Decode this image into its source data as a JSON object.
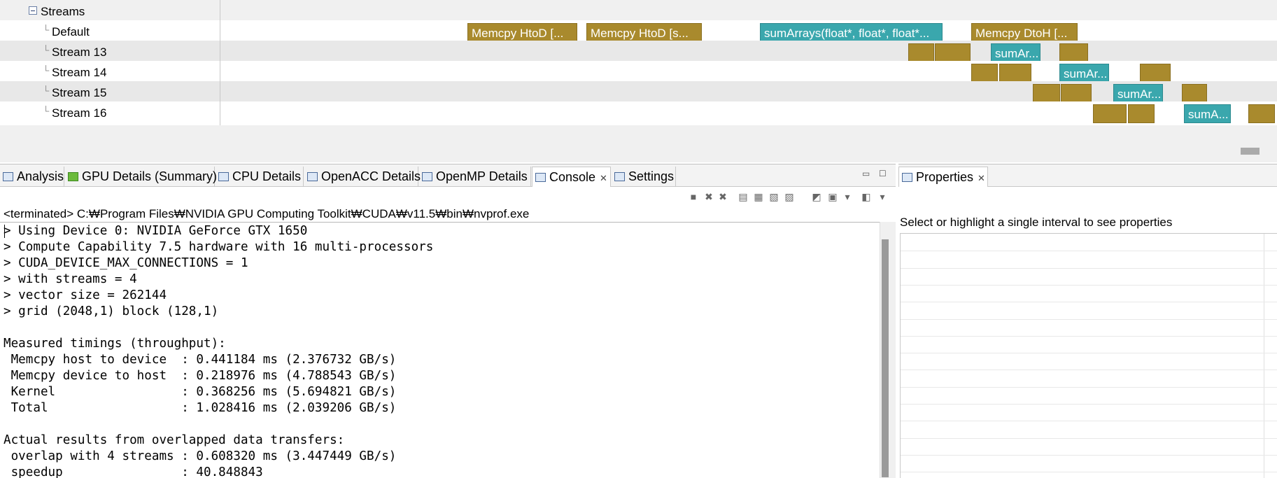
{
  "timeline": {
    "group_label": "Streams",
    "rows": [
      {
        "label": "Default",
        "bars": [
          {
            "type": "memcpy",
            "label": "Memcpy HtoD [..."
          },
          {
            "type": "memcpy",
            "label": "Memcpy HtoD [s..."
          },
          {
            "type": "kernel",
            "label": "sumArrays(float*, float*, float*..."
          },
          {
            "type": "memcpy",
            "label": "Memcpy DtoH [..."
          }
        ]
      },
      {
        "label": "Stream 13",
        "bars": [
          {
            "type": "memcpy",
            "label": ""
          },
          {
            "type": "memcpy",
            "label": ""
          },
          {
            "type": "kernel",
            "label": "sumAr..."
          },
          {
            "type": "memcpy",
            "label": ""
          }
        ]
      },
      {
        "label": "Stream 14",
        "bars": [
          {
            "type": "memcpy",
            "label": ""
          },
          {
            "type": "memcpy",
            "label": ""
          },
          {
            "type": "kernel",
            "label": "sumAr..."
          },
          {
            "type": "memcpy",
            "label": ""
          }
        ]
      },
      {
        "label": "Stream 15",
        "bars": [
          {
            "type": "memcpy",
            "label": ""
          },
          {
            "type": "memcpy",
            "label": ""
          },
          {
            "type": "kernel",
            "label": "sumAr..."
          },
          {
            "type": "memcpy",
            "label": ""
          }
        ]
      },
      {
        "label": "Stream 16",
        "bars": [
          {
            "type": "memcpy",
            "label": ""
          },
          {
            "type": "memcpy",
            "label": ""
          },
          {
            "type": "kernel",
            "label": "sumA..."
          },
          {
            "type": "memcpy",
            "label": ""
          }
        ]
      }
    ],
    "colors": {
      "memcpy": "#a98a2d",
      "kernel": "#3aa7ad"
    }
  },
  "tabs": [
    {
      "label": "Analysis",
      "icon": "analysis-icon"
    },
    {
      "label": "GPU Details (Summary)",
      "icon": "gpu-details-icon"
    },
    {
      "label": "CPU Details",
      "icon": "cpu-details-icon"
    },
    {
      "label": "OpenACC Details",
      "icon": "openacc-details-icon"
    },
    {
      "label": "OpenMP Details",
      "icon": "openmp-details-icon"
    },
    {
      "label": "Console",
      "icon": "console-icon",
      "active": true,
      "close": "✕"
    },
    {
      "label": "Settings",
      "icon": "settings-icon"
    }
  ],
  "console": {
    "terminated_line": "<terminated> C:₩Program Files₩NVIDIA GPU Computing Toolkit₩CUDA₩v11.5₩bin₩nvprof.exe",
    "lines": [
      "> Using Device 0: NVIDIA GeForce GTX 1650",
      "> Compute Capability 7.5 hardware with 16 multi-processors",
      "> CUDA_DEVICE_MAX_CONNECTIONS = 1",
      "> with streams = 4",
      "> vector size = 262144",
      "> grid (2048,1) block (128,1)",
      "",
      "Measured timings (throughput):",
      " Memcpy host to device  : 0.441184 ms (2.376732 GB/s)",
      " Memcpy device to host  : 0.218976 ms (4.788543 GB/s)",
      " Kernel                 : 0.368256 ms (5.694821 GB/s)",
      " Total                  : 1.028416 ms (2.039206 GB/s)",
      "",
      "Actual results from overlapped data transfers:",
      " overlap with 4 streams : 0.608320 ms (3.447449 GB/s)",
      " speedup                : 40.848843"
    ]
  },
  "properties": {
    "tab_label": "Properties",
    "tab_close": "✕",
    "hint": "Select or highlight a single interval to see properties"
  },
  "window_controls": {
    "minimize": "▭",
    "maximize": "☐"
  }
}
